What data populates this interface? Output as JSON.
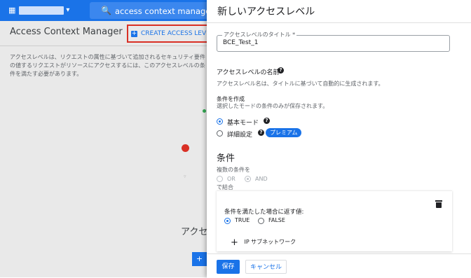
{
  "topbar": {
    "search_text": "access context manager",
    "search_icon": "🔍",
    "project_icon": "▦",
    "dropdown_icon": "▾"
  },
  "page": {
    "title": "Access Context Manager",
    "create_label": "CREATE ACCESS LEVEL",
    "description": "アクセスレベルは、リクエストの属性に基づいて追加されるセキュリティ要件の値するリクエストがリソースにアクセスするには、このアクセスレベルの条件を満たす必要があります。",
    "empty_title": "アクセスレ",
    "empty_button": "+"
  },
  "panel": {
    "title": "新しいアクセスレベル",
    "title_field": {
      "label": "アクセスレベルのタイトル *",
      "value": "BCE_Test_1"
    },
    "name_heading": "アクセスレベルの名前",
    "name_hint": "アクセスレベル名は、タイトルに基づいて自動的に生成されます。",
    "condition_create": "条件を作成",
    "condition_hint": "選択したモードの条件のみが保存されます。",
    "mode_basic": "基本モード",
    "mode_advanced": "詳細設定",
    "premium_badge": "プレミアム",
    "section_conditions": "条件",
    "combine_label": "複数の条件を",
    "or_label": "OR",
    "and_label": "AND",
    "combine_suffix": "で結合",
    "card": {
      "return_label": "条件を満たした場合に返す値:",
      "true_label": "TRUE",
      "false_label": "FALSE",
      "ip_label": "IP サブネットワーク",
      "plus_icon": "+"
    },
    "help_icon": "?",
    "save_label": "保存",
    "cancel_label": "キャンセル"
  }
}
